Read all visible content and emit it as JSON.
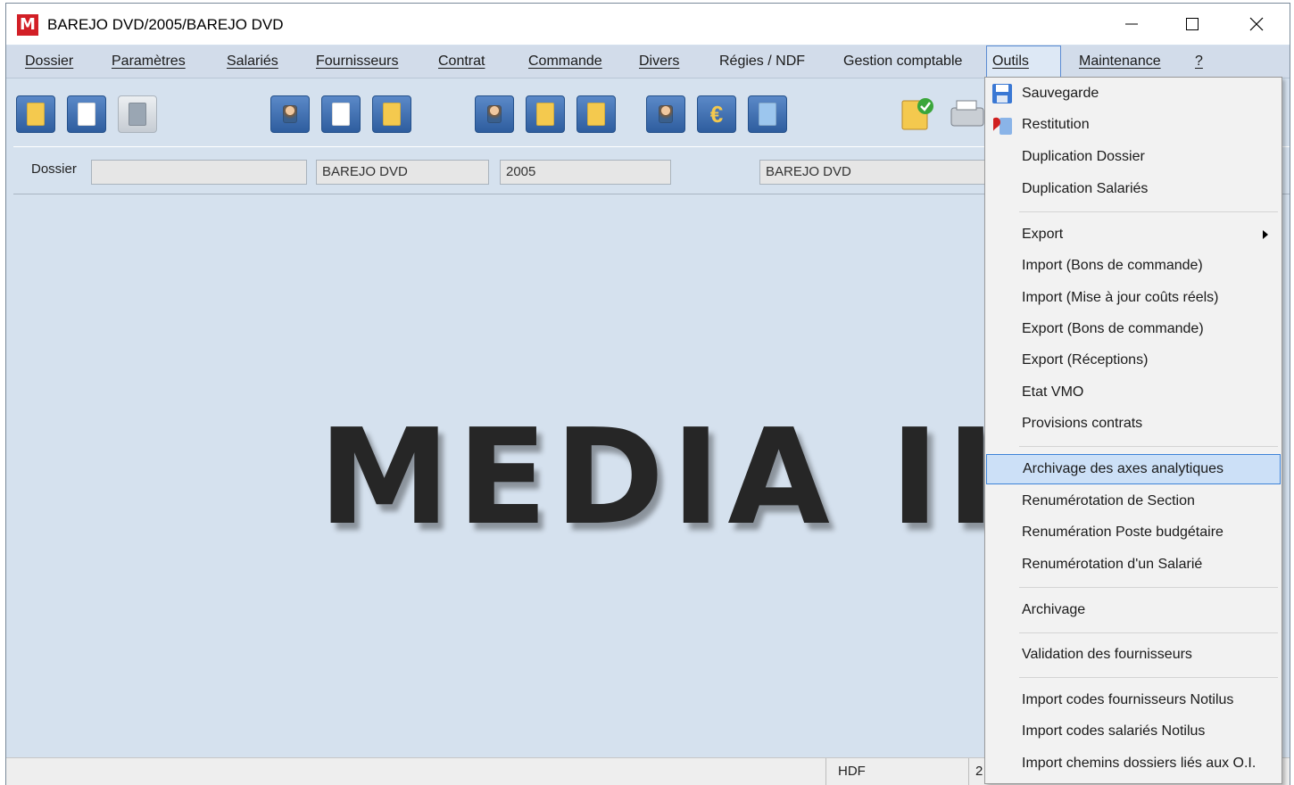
{
  "window": {
    "title": "BAREJO DVD/2005/BAREJO DVD",
    "app_icon_letter": "M",
    "controls": {
      "minimize": "—",
      "maximize": "☐",
      "close": "✕"
    }
  },
  "menu": {
    "items": [
      "Dossier",
      "Paramètres",
      "Salariés",
      "Fournisseurs",
      "Contrat",
      "Commande",
      "Divers",
      "Régies / NDF",
      "Gestion comptable",
      "Outils",
      "Maintenance",
      "?"
    ],
    "active": "Outils"
  },
  "toolbar": {
    "buttons": [
      {
        "icon": "folder-icon",
        "style": "blue"
      },
      {
        "icon": "document-icon",
        "style": "blue"
      },
      {
        "icon": "disabled-tool-icon",
        "style": "gray"
      },
      {
        "icon": "employee-icon",
        "style": "blue"
      },
      {
        "icon": "edit-document-icon",
        "style": "blue"
      },
      {
        "icon": "open-book-icon",
        "style": "blue"
      },
      {
        "icon": "supplier-icon",
        "style": "blue"
      },
      {
        "icon": "contract-icon",
        "style": "blue"
      },
      {
        "icon": "search-person-icon",
        "style": "blue"
      },
      {
        "icon": "payroll-icon",
        "style": "blue"
      },
      {
        "icon": "euro-icon",
        "style": "blue"
      },
      {
        "icon": "chart-icon",
        "style": "blue"
      },
      {
        "icon": "validated-folder-icon",
        "style": "open"
      },
      {
        "icon": "printer-icon",
        "style": "open"
      }
    ]
  },
  "dossier": {
    "label": "Dossier",
    "field1": "",
    "field2": "BAREJO DVD",
    "field3": "2005",
    "field4": "BAREJO DVD"
  },
  "logo": "MEDIA II",
  "status": {
    "cell1": "HDF",
    "cell2": "2"
  },
  "outils_menu": {
    "sauvegarde": "Sauvegarde",
    "restitution": "Restitution",
    "duplication_dossier": "Duplication Dossier",
    "duplication_salaries": "Duplication Salariés",
    "export": "Export",
    "import_bons": "Import (Bons de commande)",
    "import_maj": "Import (Mise à jour coûts réels)",
    "export_bons": "Export (Bons de commande)",
    "export_receptions": "Export (Réceptions)",
    "etat_vmo": "Etat VMO",
    "provisions": "Provisions contrats",
    "archivage_axes": "Archivage des axes analytiques",
    "renum_section": "Renumérotation de Section",
    "renum_poste": "Renumération Poste budgétaire",
    "renum_salarie": "Renumérotation d'un Salarié",
    "archivage": "Archivage",
    "validation_fournisseurs": "Validation des fournisseurs",
    "import_codes_fournisseurs": "Import codes fournisseurs Notilus",
    "import_codes_salaries": "Import codes salariés Notilus",
    "import_chemins": "Import chemins dossiers liés aux O.I.",
    "highlighted": "Archivage des axes analytiques"
  }
}
